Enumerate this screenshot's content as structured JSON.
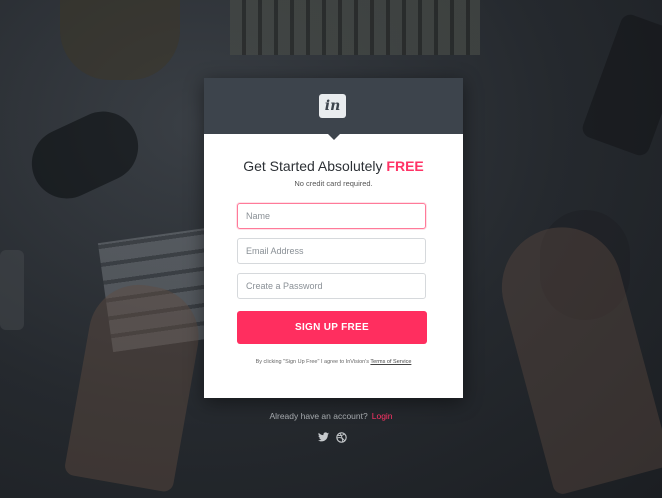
{
  "logo": {
    "text": "in"
  },
  "heading": {
    "prefix": "Get Started Absolutely ",
    "accent": "FREE"
  },
  "subtitle": "No credit card required.",
  "form": {
    "name_placeholder": "Name",
    "email_placeholder": "Email Address",
    "password_placeholder": "Create a Password",
    "submit_label": "SIGN UP FREE"
  },
  "terms": {
    "prefix": "By clicking \"Sign Up Free\" I agree to InVision's ",
    "link": "Terms of Service"
  },
  "login": {
    "prompt": "Already have an account?",
    "link": "Login"
  },
  "social": {
    "icons": [
      "twitter-icon",
      "dribbble-icon"
    ]
  },
  "colors": {
    "accent": "#ff2e5f",
    "header": "#3d444c"
  }
}
